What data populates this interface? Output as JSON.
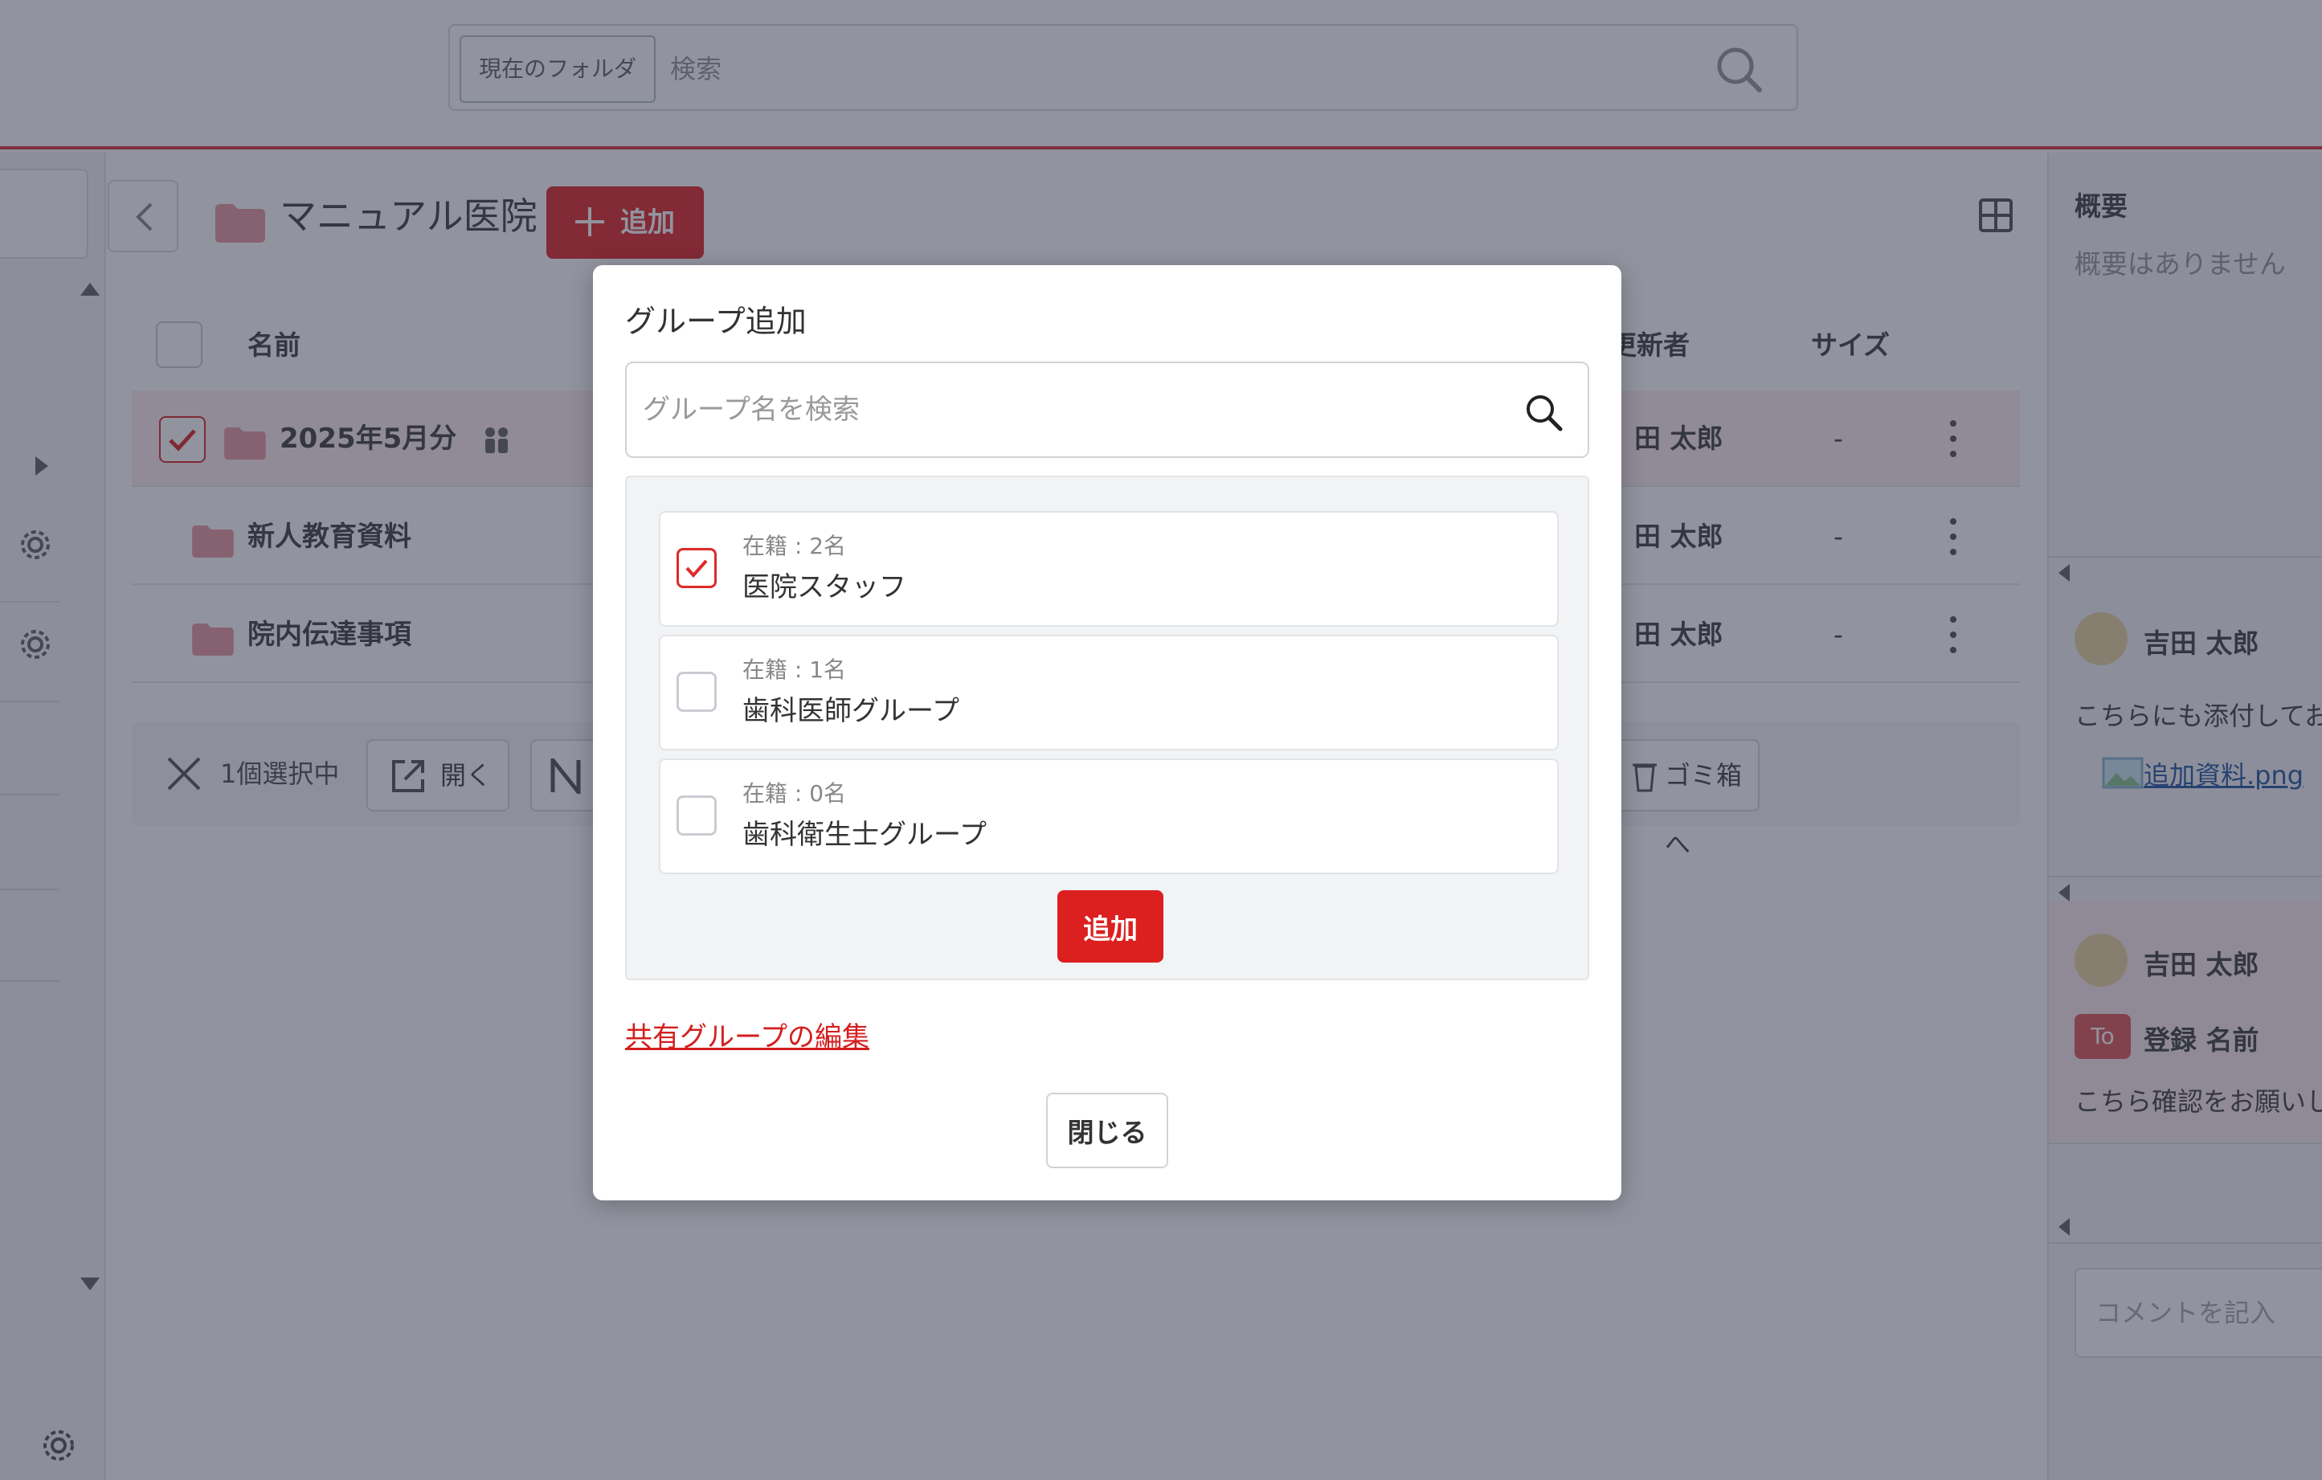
{
  "topbar": {
    "scope_button": "現在のフォルダ",
    "search_placeholder": "検索"
  },
  "folder": {
    "title": "マニュアル医院",
    "add_label": "追加"
  },
  "table": {
    "headers": {
      "name": "名前",
      "updater": "更新者",
      "size": "サイズ"
    },
    "rows": [
      {
        "name": "2025年5月分",
        "updater": "田 太郎",
        "size": "-",
        "selected": true
      },
      {
        "name": "新人教育資料",
        "updater": "田 太郎",
        "size": "-",
        "selected": false
      },
      {
        "name": "院内伝達事項",
        "updater": "田 太郎",
        "size": "-",
        "selected": false
      }
    ]
  },
  "actionbar": {
    "count": "1個選択中",
    "open": "開く",
    "trash": "ゴミ箱へ"
  },
  "rightpanel": {
    "summary_title": "概要",
    "summary_empty": "概要はありません",
    "comment1": {
      "user": "吉田 太郎",
      "text": "こちらにも添付しておき",
      "attachment": "追加資料.png"
    },
    "comment2": {
      "user": "吉田 太郎",
      "to_badge": "To",
      "to_name": "登録 名前",
      "text": "こちら確認をお願いしま"
    },
    "comment_placeholder": "コメントを記入"
  },
  "modal": {
    "title": "グループ追加",
    "search_placeholder": "グループ名を検索",
    "groups": [
      {
        "count": "在籍 : 2名",
        "name": "医院スタッフ",
        "checked": true
      },
      {
        "count": "在籍 : 1名",
        "name": "歯科医師グループ",
        "checked": false
      },
      {
        "count": "在籍 : 0名",
        "name": "歯科衛生士グループ",
        "checked": false
      }
    ],
    "add_button": "追加",
    "edit_link": "共有グループの編集",
    "close_button": "閉じる"
  },
  "colors": {
    "accent": "#dc1f1f",
    "overlay": "#232a40"
  }
}
